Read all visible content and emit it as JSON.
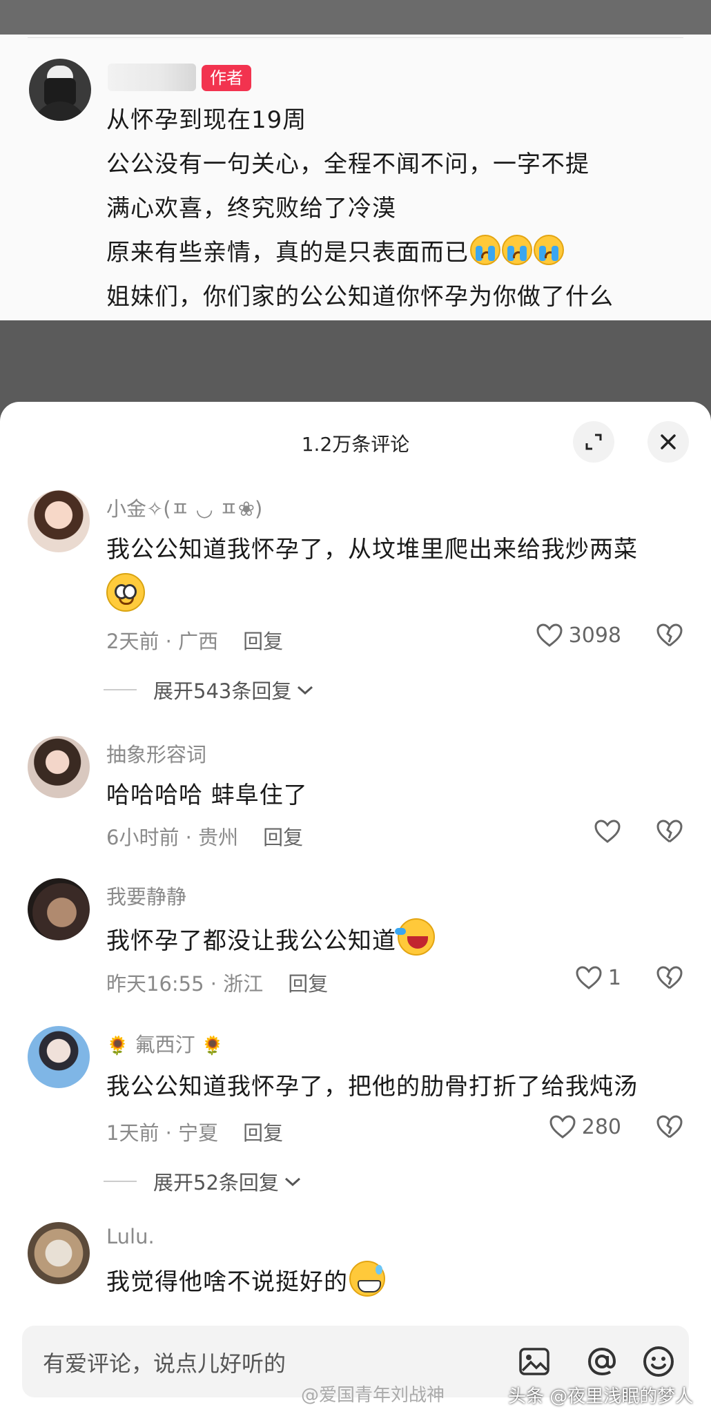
{
  "post": {
    "author_badge": "作者",
    "lines": [
      "从怀孕到现在19周",
      "公公没有一句关心，全程不闻不问，一字不提",
      "满心欢喜，终究败给了冷漠",
      "原来有些亲情，真的是只表面而已",
      "姐妹们，你们家的公公知道你怀孕为你做了什么"
    ],
    "emoji": "crying-emoji"
  },
  "sheet": {
    "title": "1.2万条评论",
    "expand_icon": "expand-icon",
    "close_icon": "close-icon"
  },
  "comments": [
    {
      "name": "小金✧(ㅍ ◡ ㅍ❀)",
      "text": "我公公知道我怀孕了，从坟堆里爬出来给我炒两菜",
      "time": "2天前",
      "location": "广西",
      "reply": "回复",
      "likes": "3098",
      "expand": "展开543条回复"
    },
    {
      "name": "抽象形容词",
      "text": "哈哈哈哈   蚌阜住了",
      "time": "6小时前",
      "location": "贵州",
      "reply": "回复",
      "likes": ""
    },
    {
      "name": "我要静静",
      "text": "我怀孕了都没让我公公知道",
      "time": "昨天16:55",
      "location": "浙江",
      "reply": "回复",
      "likes": "1"
    },
    {
      "name": "氟西汀",
      "text": "我公公知道我怀孕了，把他的肋骨打折了给我炖汤",
      "time": "1天前",
      "location": "宁夏",
      "reply": "回复",
      "likes": "280",
      "expand": "展开52条回复"
    },
    {
      "name": "Lulu.",
      "text": "我觉得他啥不说挺好的"
    }
  ],
  "input": {
    "placeholder": "有爱评论，说点儿好听的",
    "icons": [
      "image-icon",
      "at-icon",
      "emoji-icon"
    ]
  },
  "watermarks": {
    "weibo": "@爱国青年刘战神",
    "toutiao": "头条 @夜里浅眠的梦人"
  },
  "colors": {
    "badge": "#f2334f",
    "overlay": "#5b5b5b"
  }
}
